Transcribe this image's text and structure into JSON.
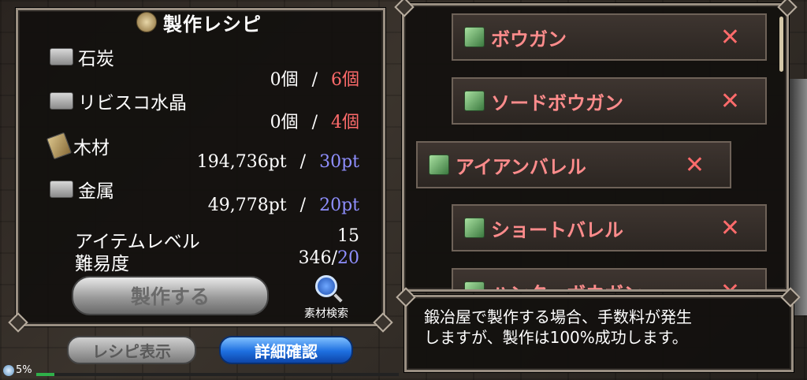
{
  "window": {
    "title": "製作レシピ"
  },
  "materials": [
    {
      "name": "石炭",
      "icon": "ore-icon",
      "have": "0個",
      "sep": "/",
      "need": "6個",
      "need_color": "red"
    },
    {
      "name": "リビスコ水晶",
      "icon": "ore-icon",
      "have": "0個",
      "sep": "/",
      "need": "4個",
      "need_color": "red"
    },
    {
      "name": "木材",
      "icon": "wood-icon",
      "have": "194,736pt",
      "sep": "/",
      "need": "30pt",
      "need_color": "blue"
    },
    {
      "name": "金属",
      "icon": "ore-icon",
      "have": "49,778pt",
      "sep": "/",
      "need": "20pt",
      "need_color": "blue"
    }
  ],
  "stats": {
    "item_level_label": "アイテムレベル",
    "item_level_value": "15",
    "difficulty_label": "難易度",
    "difficulty_current": "346",
    "difficulty_sep": "/",
    "difficulty_max": "20"
  },
  "buttons": {
    "craft": "製作する",
    "material_search": "素材検索",
    "recipe_display": "レシピ表示",
    "detail_confirm": "詳細確認"
  },
  "status": {
    "percent": "5%",
    "xp_fraction": 0.05
  },
  "recipe_list": [
    {
      "name": "ボウガン",
      "remove": "✕"
    },
    {
      "name": "ソードボウガン",
      "remove": "✕"
    },
    {
      "name": "アイアンバレル",
      "remove": "✕",
      "selected": true
    },
    {
      "name": "ショートバレル",
      "remove": "✕"
    },
    {
      "name": "ハンターボウガン",
      "remove": "✕"
    }
  ],
  "message": {
    "line1": "鍛冶屋で製作する場合、手数料が発生",
    "line2": "しますが、製作は100%成功します。"
  }
}
